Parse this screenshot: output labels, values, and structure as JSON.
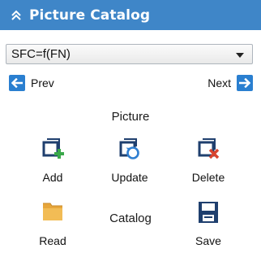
{
  "header": {
    "title": "Picture Catalog",
    "collapse_icon": "double-chevron-up-icon",
    "background": "#3f86c8"
  },
  "selector": {
    "value": "SFC=f(FN)"
  },
  "navigation": {
    "prev_label": "Prev",
    "next_label": "Next",
    "icon_color": "#2a7fd0"
  },
  "picture_section": {
    "title": "Picture",
    "add_label": "Add",
    "update_label": "Update",
    "delete_label": "Delete"
  },
  "catalog_section": {
    "title": "Catalog",
    "read_label": "Read",
    "save_label": "Save"
  },
  "colors": {
    "icon_navy": "#1f3f6e",
    "add_green": "#3aa84a",
    "update_blue": "#2f7fd1",
    "delete_red": "#d8442f",
    "folder": "#e7a63b"
  }
}
